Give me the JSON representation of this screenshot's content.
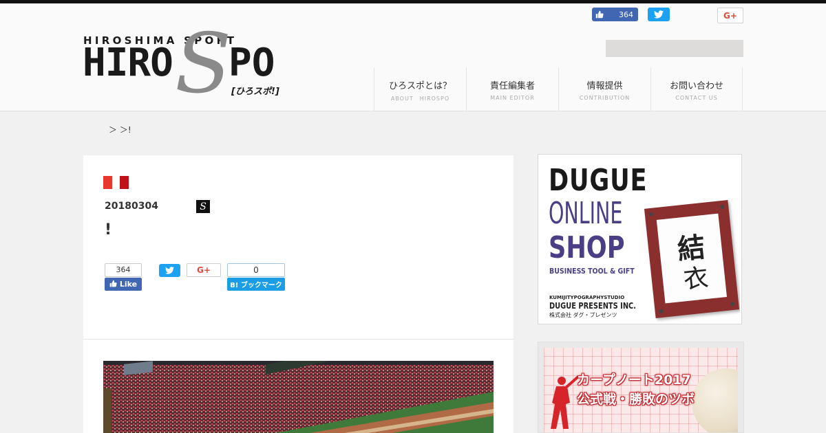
{
  "site": {
    "logo": {
      "subtitle": "HIROSHIMA SPORT",
      "main_left": "HIRO",
      "main_mid": "S",
      "main_right": "PO",
      "japanese": "[ひろスポ!]"
    },
    "colors": {
      "top_bar": "#111111",
      "facebook": "#4267b2",
      "twitter": "#1da1f2",
      "google_plus": "#dd4b39",
      "hatena": "#1b9ee6",
      "category_red_1": "#e8382e",
      "category_red_2": "#c0101a"
    }
  },
  "header_social": {
    "fb_icon": "thumbs-up-icon",
    "fb_count": "364",
    "twitter_icon": "twitter-bird-icon",
    "gplus_label": "G+"
  },
  "nav": {
    "items": [
      {
        "jp": "ひろスポとは？",
        "en": "ABOUT　HIROSPO"
      },
      {
        "jp": "責任編集者",
        "en": "MAIN EDITOR"
      },
      {
        "jp": "情報提供",
        "en": "CONTRIBUTION"
      },
      {
        "jp": "お問い合わせ",
        "en": "CONTACT US"
      }
    ]
  },
  "breadcrumb": {
    "text": "＞ ＞!"
  },
  "article": {
    "date": "20180304",
    "author_icon_letter": "S",
    "title": "!",
    "share": {
      "fb_count": "364",
      "fb_label": "Like",
      "gplus_label": "G+",
      "hatena_count": "0",
      "hatena_label": "B! ブックマーク"
    }
  },
  "sidebar": {
    "ad1": {
      "line1": "DUGUE",
      "line2": "ONLINE",
      "line3": "SHOP",
      "line4": "BUSINESS TOOL & GIFT",
      "studio": "KUMIJITYPOGRAPHYSTUDIO",
      "presents": "DUGUE PRESENTS INC.",
      "company": "株式会社 ダグ・プレゼンツ",
      "kanji1": "結",
      "kanji2": "衣"
    },
    "ad2": {
      "title1": "カープノート2017",
      "title2": "公式戦・勝敗のツボ"
    }
  }
}
